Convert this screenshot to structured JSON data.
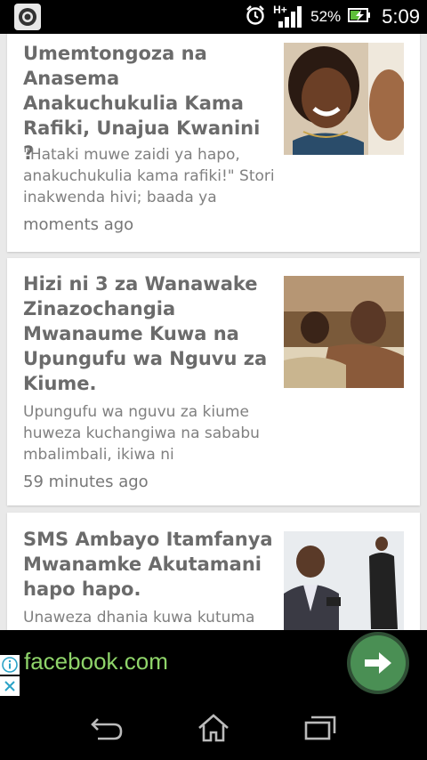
{
  "status_bar": {
    "network": "H+",
    "battery": "52%",
    "time": "5:09",
    "icons": [
      "app-notification-icon",
      "alarm-icon",
      "signal-icon",
      "battery-icon"
    ]
  },
  "articles": [
    {
      "title": "Umemtongoza na Anasema Anakuchukulia Kama Rafiki, Unajua Kwanini ?",
      "excerpt": "\"Hataki muwe zaidi ya hapo, anakuchukulia kama rafiki!\" Stori inakwenda hivi; baada ya",
      "time": "moments ago",
      "thumbnail": "smiling-woman-photo"
    },
    {
      "title": "Hizi ni 3 za Wanawake Zinazochangia Mwanaume Kuwa na Upungufu wa Nguvu za Kiume.",
      "excerpt": "Upungufu wa nguvu za kiume huweza kuchangiwa na sababu mbalimbali, ikiwa ni",
      "time": "59 minutes ago",
      "thumbnail": "couple-in-bed-photo"
    },
    {
      "title": "SMS Ambayo Itamfanya Mwanamke Akutamani hapo hapo.",
      "excerpt": "Unaweza dhania kuwa kutuma",
      "time": "",
      "thumbnail": "man-with-phone-photo"
    }
  ],
  "ad": {
    "domain": "facebook.com",
    "accent": "#8fd46a",
    "button_color": "#4a8f54"
  },
  "nav": {
    "back": "back-icon",
    "home": "home-icon",
    "recents": "recents-icon"
  }
}
